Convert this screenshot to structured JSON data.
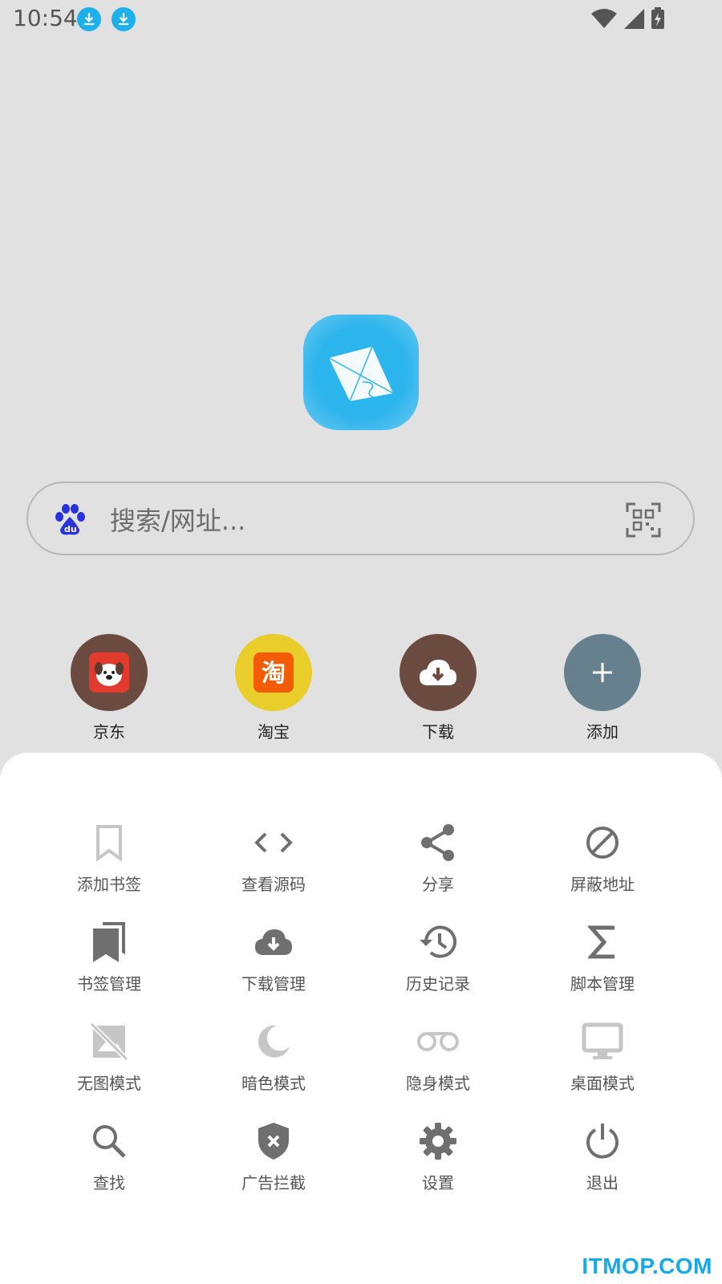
{
  "status_bar": {
    "time": "10:54"
  },
  "search": {
    "placeholder": "搜索/网址..."
  },
  "shortcuts": [
    {
      "label": "京东",
      "color": "#6b4a40"
    },
    {
      "label": "淘宝",
      "color": "#e8cd2b"
    },
    {
      "label": "下载",
      "color": "#6b4a40"
    },
    {
      "label": "添加",
      "color": "#67808e"
    }
  ],
  "menu": {
    "rows": [
      [
        {
          "label": "添加书签",
          "icon": "bookmark-outline-icon"
        },
        {
          "label": "查看源码",
          "icon": "code-icon"
        },
        {
          "label": "分享",
          "icon": "share-icon"
        },
        {
          "label": "屏蔽地址",
          "icon": "block-icon"
        }
      ],
      [
        {
          "label": "书签管理",
          "icon": "bookmarks-icon"
        },
        {
          "label": "下载管理",
          "icon": "cloud-download-icon"
        },
        {
          "label": "历史记录",
          "icon": "history-icon"
        },
        {
          "label": "脚本管理",
          "icon": "sigma-icon"
        }
      ],
      [
        {
          "label": "无图模式",
          "icon": "no-image-icon"
        },
        {
          "label": "暗色模式",
          "icon": "moon-icon"
        },
        {
          "label": "隐身模式",
          "icon": "incognito-icon"
        },
        {
          "label": "桌面模式",
          "icon": "desktop-icon"
        }
      ],
      [
        {
          "label": "查找",
          "icon": "search-icon"
        },
        {
          "label": "广告拦截",
          "icon": "shield-block-icon"
        },
        {
          "label": "设置",
          "icon": "gear-icon"
        },
        {
          "label": "退出",
          "icon": "power-icon"
        }
      ]
    ]
  },
  "watermark": "ITMOP.COM",
  "colors": {
    "icon_dark": "#6f6f6f",
    "icon_light": "#c6c6c6",
    "accent": "#1eb0ea"
  }
}
